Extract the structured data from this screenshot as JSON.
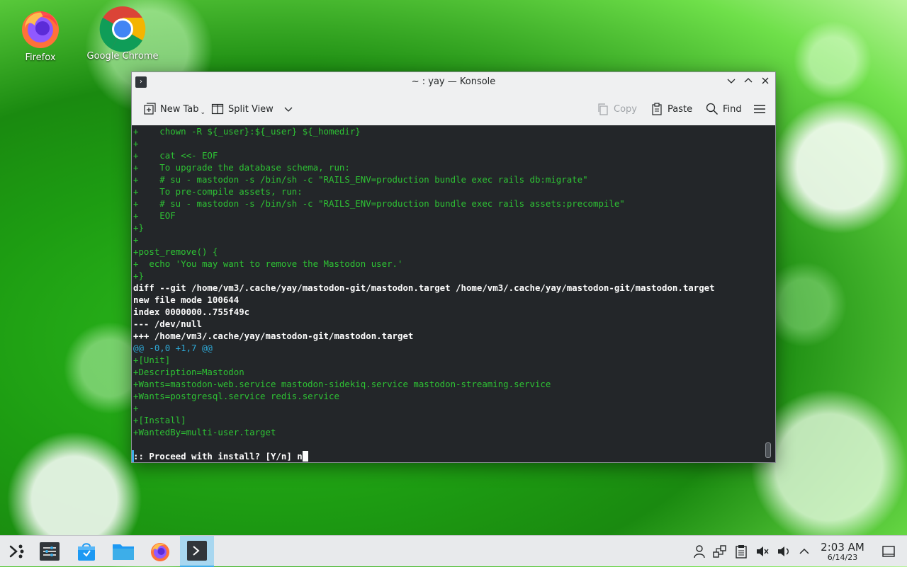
{
  "desktop": {
    "icons": [
      {
        "label": "Firefox"
      },
      {
        "label": "Google Chrome"
      }
    ]
  },
  "window": {
    "title": "~ : yay — Konsole",
    "toolbar": {
      "new_tab": "New Tab",
      "split_view": "Split View",
      "copy": "Copy",
      "paste": "Paste",
      "find": "Find"
    }
  },
  "terminal": {
    "lines": [
      "+    chown -R ${_user}:${_user} ${_homedir}",
      "+",
      "+    cat <<- EOF",
      "+    To upgrade the database schema, run:",
      "+    # su - mastodon -s /bin/sh -c \"RAILS_ENV=production bundle exec rails db:migrate\"",
      "+    To pre-compile assets, run:",
      "+    # su - mastodon -s /bin/sh -c \"RAILS_ENV=production bundle exec rails assets:precompile\"",
      "+    EOF",
      "+}",
      "+",
      "+post_remove() {",
      "+  echo 'You may want to remove the Mastodon user.'",
      "+}",
      "diff --git /home/vm3/.cache/yay/mastodon-git/mastodon.target /home/vm3/.cache/yay/mastodon-git/mastodon.target",
      "new file mode 100644",
      "index 0000000..755f49c",
      "--- /dev/null",
      "+++ /home/vm3/.cache/yay/mastodon-git/mastodon.target",
      "@@ -0,0 +1,7 @@",
      "+[Unit]",
      "+Description=Mastodon",
      "+Wants=mastodon-web.service mastodon-sidekiq.service mastodon-streaming.service",
      "+Wants=postgresql.service redis.service",
      "+",
      "+[Install]",
      "+WantedBy=multi-user.target",
      "",
      ":: Proceed with install? [Y/n] n"
    ],
    "line_styles": [
      "g",
      "g",
      "g",
      "g",
      "g",
      "g",
      "g",
      "g",
      "g",
      "g",
      "g",
      "g",
      "g",
      "w",
      "w",
      "w",
      "w",
      "w",
      "cy",
      "g",
      "g",
      "g",
      "g",
      "g",
      "g",
      "g",
      "g",
      "w"
    ]
  },
  "taskbar": {
    "clock_time": "2:03 AM",
    "clock_date": "6/14/23",
    "tasks": [
      "application-launcher-icon",
      "pager-icon",
      "discover-icon",
      "files-icon",
      "firefox-icon",
      "konsole-icon"
    ],
    "tray": [
      "user-icon",
      "network-icon",
      "clipboard-icon",
      "mute-icon",
      "volume-icon",
      "expand-tray-icon",
      "show-desktop-icon"
    ]
  },
  "colors": {
    "terminal_bg": "#232629",
    "diff_green": "#2ec234",
    "hunk_cyan": "#2eaad8",
    "accent": "#3daee9"
  }
}
